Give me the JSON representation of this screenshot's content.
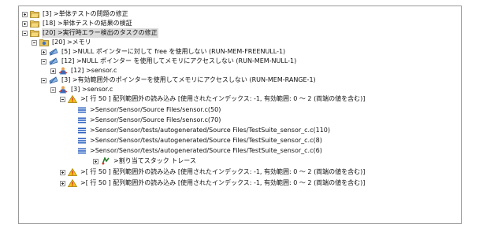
{
  "tree": {
    "rows": [
      {
        "expander": "plus",
        "icon": "folder-open-icon",
        "label": "[3] >単体テストの問題の修正"
      },
      {
        "expander": "plus",
        "icon": "folder-open-icon",
        "label": "[18] >単体テストの結果の検証"
      },
      {
        "expander": "minus",
        "icon": "folder-open-icon",
        "label": "[20] >実行時エラー検出のタスクの修正",
        "selected": true
      },
      {
        "expander": "minus",
        "icon": "folder-category-icon",
        "label": "[20] >メモリ"
      },
      {
        "expander": "plus",
        "icon": "checker-rule-icon",
        "label": "[5] >NULL ポインターに対して free を使用しない (RUN-MEM-FREENULL-1)"
      },
      {
        "expander": "minus",
        "icon": "checker-rule-icon",
        "label": "[12] >NULL ポインター を使用してメモリにアクセスしない (RUN-MEM-NULL-1)"
      },
      {
        "expander": "plus",
        "icon": "developer-icon",
        "label": "[12] >sensor.c"
      },
      {
        "expander": "minus",
        "icon": "checker-rule-icon",
        "label": "[3] >有効範囲外のポインターを使用してメモリにアクセスしない (RUN-MEM-RANGE-1)"
      },
      {
        "expander": "minus",
        "icon": "developer-icon",
        "label": "[3] >sensor.c"
      },
      {
        "expander": "minus",
        "icon": "warning-icon",
        "label": ">[ 行 50 ] 配列範囲外の読み込み [使用されたインデックス: -1, 有効範囲: 0 ～ 2 (両端の値を含む)]"
      },
      {
        "expander": "none",
        "icon": "stack-frame-icon",
        "label": ">Sensor/Sensor/Source Files/sensor.c(50)"
      },
      {
        "expander": "none",
        "icon": "stack-frame-icon",
        "label": ">Sensor/Sensor/Source Files/sensor.c(70)"
      },
      {
        "expander": "none",
        "icon": "stack-frame-icon",
        "label": ">Sensor/Sensor/tests/autogenerated/Source Files/TestSuite_sensor_c.c(110)"
      },
      {
        "expander": "none",
        "icon": "stack-frame-icon",
        "label": ">Sensor/Sensor/tests/autogenerated/Source Files/TestSuite_sensor_c.c(8)"
      },
      {
        "expander": "none",
        "icon": "stack-frame-icon",
        "label": ">Sensor/Sensor/tests/autogenerated/Source Files/TestSuite_sensor_c.c(6)"
      },
      {
        "expander": "plus",
        "icon": "allocation-trace-icon",
        "label": ">割り当てスタック トレース"
      },
      {
        "expander": "plus",
        "icon": "warning-icon",
        "label": ">[ 行 50 ] 配列範囲外の読み込み [使用されたインデックス: -1, 有効範囲: 0 ～ 2 (両端の値を含む)]"
      },
      {
        "expander": "plus",
        "icon": "warning-icon",
        "label": ">[ 行 50 ] 配列範囲外の読み込み [使用されたインデックス: -1, 有効範囲: 0 ～ 2 (両端の値を含む)]"
      }
    ]
  }
}
